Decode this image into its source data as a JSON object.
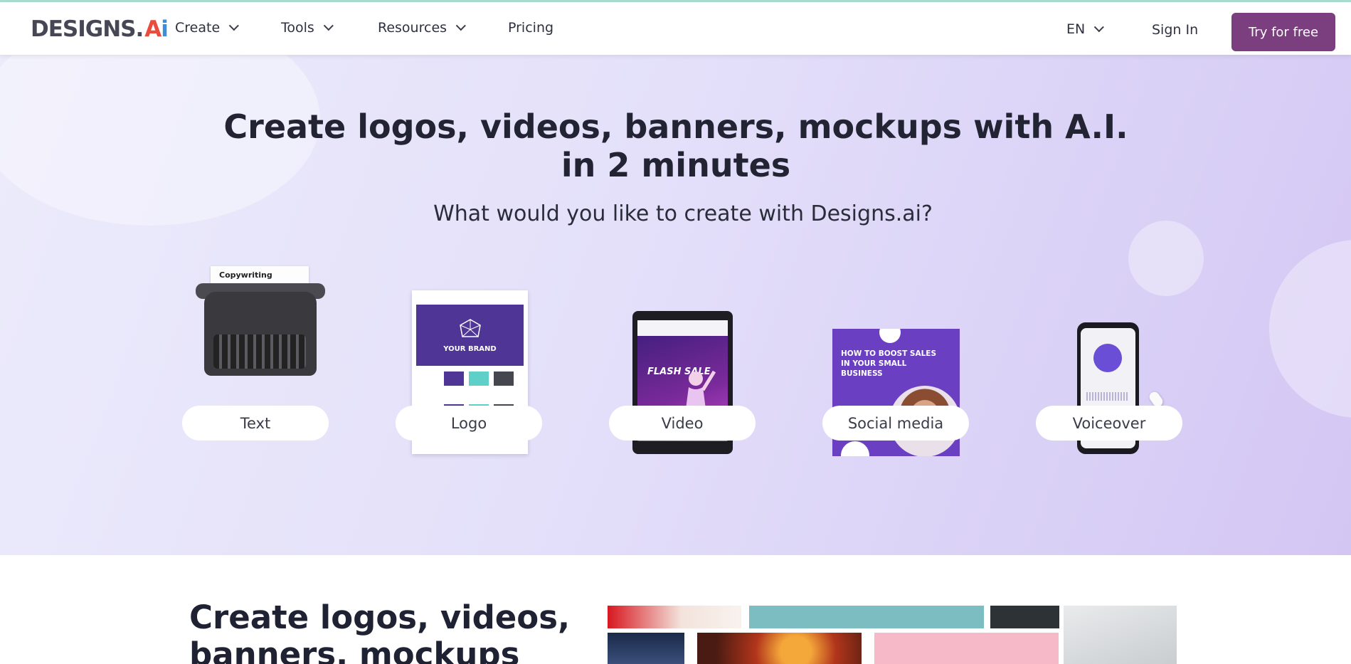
{
  "nav": {
    "logo_text": "DESIGNS.",
    "logo_ai": [
      "A",
      "i"
    ],
    "items": [
      {
        "label": "Create",
        "dropdown": true
      },
      {
        "label": "Tools",
        "dropdown": true
      },
      {
        "label": "Resources",
        "dropdown": true
      },
      {
        "label": "Pricing",
        "dropdown": false
      }
    ],
    "language": "EN",
    "signin": "Sign In",
    "cta": "Try for free"
  },
  "hero": {
    "title": "Create logos, videos, banners, mockups with A.I. in 2 minutes",
    "subtitle": "What would you like to create with Designs.ai?",
    "options": [
      {
        "label": "Text",
        "icon": "typewriter-icon"
      },
      {
        "label": "Logo",
        "icon": "brand-sheet-icon"
      },
      {
        "label": "Video",
        "icon": "tablet-video-icon"
      },
      {
        "label": "Social media",
        "icon": "social-post-icon"
      },
      {
        "label": "Voiceover",
        "icon": "phone-voice-icon"
      }
    ],
    "thumb_text": {
      "copywriting": "Copywriting",
      "your_brand": "YOUR BRAND",
      "flash_sale": "FLASH SALE",
      "social_title": "HOW TO BOOST SALES IN YOUR SMALL BUSINESS"
    }
  },
  "lower": {
    "title": "Create logos, videos, banners, mockups"
  },
  "colors": {
    "brand_purple": "#7b3f80",
    "hero_bg": "#e4e0fa",
    "text_dark": "#222433"
  }
}
